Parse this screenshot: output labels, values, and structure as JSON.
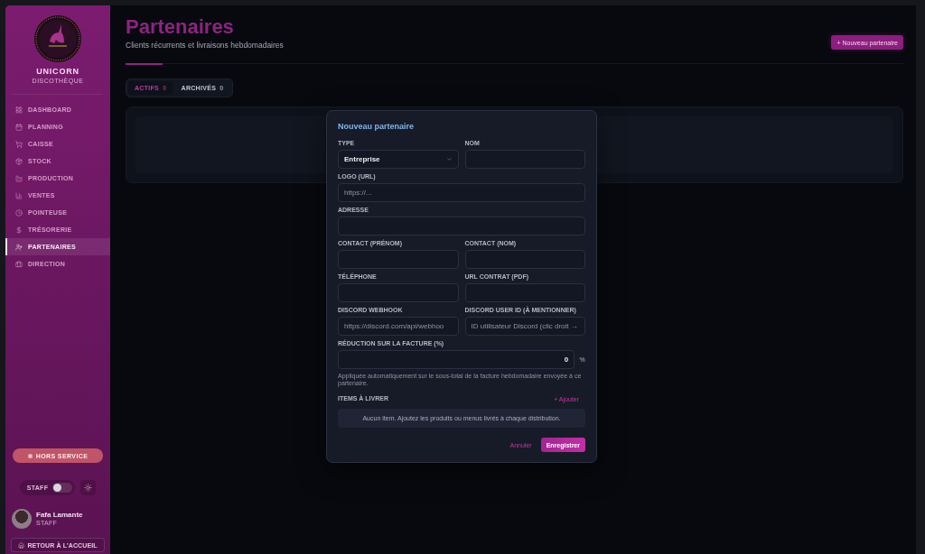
{
  "sidebar": {
    "brand": {
      "name": "UNICORN",
      "tagline": "DISCOTHÈQUE"
    },
    "nav": [
      {
        "label": "DASHBOARD",
        "selected": false
      },
      {
        "label": "PLANNING",
        "selected": false
      },
      {
        "label": "CAISSE",
        "selected": false
      },
      {
        "label": "STOCK",
        "selected": false
      },
      {
        "label": "PRODUCTION",
        "selected": false
      },
      {
        "label": "VENTES",
        "selected": false
      },
      {
        "label": "POINTEUSE",
        "selected": false
      },
      {
        "label": "TRÉSORERIE",
        "selected": false
      },
      {
        "label": "PARTENAIRES",
        "selected": true
      },
      {
        "label": "DIRECTION",
        "selected": false
      }
    ],
    "status_button": {
      "label": "HORS SERVICE"
    },
    "mode_toggle": {
      "label": "STAFF",
      "on": false
    },
    "user": {
      "name": "Fafa Lamante",
      "role": "STAFF"
    },
    "home_link": {
      "label": "RETOUR À L'ACCUEIL"
    }
  },
  "page": {
    "title": "Partenaires",
    "subtitle": "Clients récurrents et livraisons hebdomadaires",
    "new_button": "+ Nouveau partenaire"
  },
  "tabs": [
    {
      "label": "ACTIFS",
      "count": "0",
      "selected": true
    },
    {
      "label": "ARCHIVÉS",
      "count": "0",
      "selected": false
    }
  ],
  "modal": {
    "title": "Nouveau partenaire",
    "rows": [
      [
        {
          "label": "TYPE",
          "kind": "select",
          "value": "Entreprise"
        },
        {
          "label": "NOM",
          "kind": "input"
        }
      ],
      [
        {
          "label": "LOGO (URL)",
          "kind": "input",
          "placeholder": "https://..."
        }
      ],
      [
        {
          "label": "ADRESSE",
          "kind": "input"
        }
      ],
      [
        {
          "label": "CONTACT (PRÉNOM)",
          "kind": "input"
        },
        {
          "label": "CONTACT (NOM)",
          "kind": "input"
        }
      ],
      [
        {
          "label": "TÉLÉPHONE",
          "kind": "input"
        },
        {
          "label": "URL CONTRAT (PDF)",
          "kind": "input"
        }
      ],
      [
        {
          "label": "DISCORD WEBHOOK",
          "kind": "input",
          "placeholder": "https://discord.com/api/webhoo"
        },
        {
          "label": "DISCORD USER ID (À MENTIONNER)",
          "kind": "input",
          "placeholder": "ID utilisateur Discord (clic droit →"
        }
      ]
    ],
    "discount": {
      "label": "RÉDUCTION SUR LA FACTURE (%)",
      "value": "0",
      "suffix": "%",
      "help": "Appliquée automatiquement sur le sous-total de la facture hebdomadaire envoyée à ce partenaire."
    },
    "items": {
      "label": "ITEMS À LIVRER",
      "add_button": "+ Ajouter",
      "empty_text": "Aucun item. Ajoutez les produits ou menus livrés à chaque distribution."
    },
    "buttons": [
      {
        "label": "Annuler",
        "kind": "text"
      },
      {
        "label": "Enregistrer",
        "kind": "primary"
      }
    ]
  }
}
